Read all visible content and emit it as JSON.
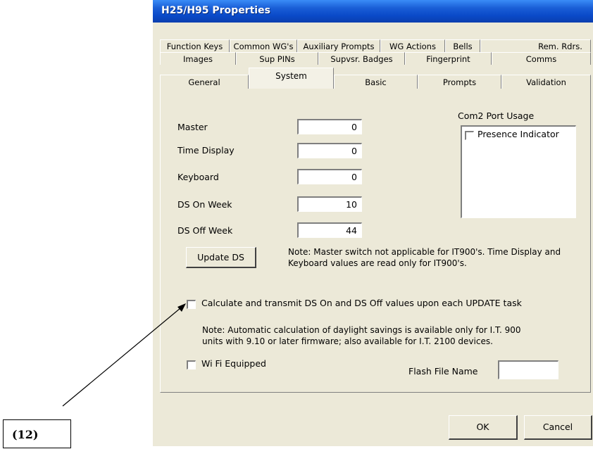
{
  "window": {
    "title": "H25/H95 Properties"
  },
  "tabs": {
    "row1": [
      "Function Keys",
      "Common WG's",
      "Auxiliary Prompts",
      "WG Actions",
      "Bells",
      "Rem. Rdrs."
    ],
    "row2": [
      "Images",
      "Sup PINs",
      "Supvsr. Badges",
      "Fingerprint",
      "Comms"
    ],
    "row3": [
      "General",
      "System",
      "Basic",
      "Prompts",
      "Validation"
    ],
    "selected": "System"
  },
  "system": {
    "fields": [
      {
        "label": "Master",
        "value": "0"
      },
      {
        "label": "Time Display",
        "value": "0"
      },
      {
        "label": "Keyboard",
        "value": "0"
      },
      {
        "label": "DS On Week",
        "value": "10"
      },
      {
        "label": "DS Off Week",
        "value": "44"
      }
    ],
    "com2": {
      "title": "Com2 Port Usage",
      "option": "Presence Indicator",
      "checked": false
    },
    "update_ds_label": "Update DS",
    "note1_line1": "Note: Master switch not applicable for IT900's.  Time Display and",
    "note1_line2": "Keyboard values are read only for IT900's.",
    "calc_checkbox_label": "Calculate and transmit DS On and DS Off values upon each UPDATE task",
    "note2_line1": "Note: Automatic calculation of daylight savings is available only for I.T. 900",
    "note2_line2": "units with 9.10 or later firmware; also available for I.T. 2100 devices.",
    "wifi_label": "Wi Fi Equipped",
    "flash_label": "Flash File Name",
    "flash_value": ""
  },
  "buttons": {
    "ok": "OK",
    "cancel": "Cancel"
  },
  "callout": {
    "label": "(12)"
  }
}
